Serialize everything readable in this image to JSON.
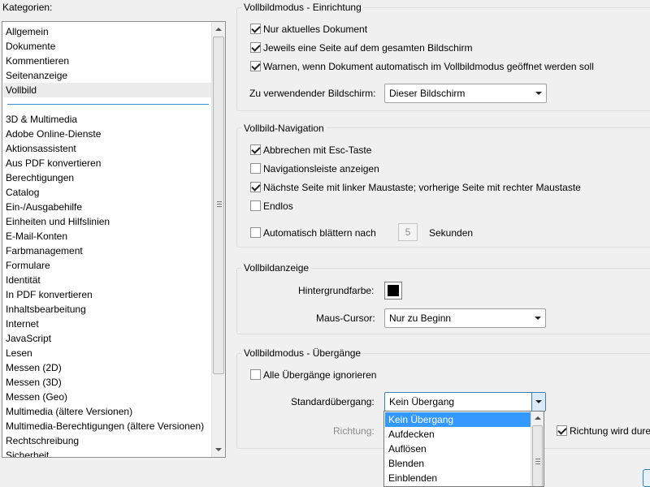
{
  "categories": {
    "label": "Kategorien:",
    "top_items": [
      "Allgemein",
      "Dokumente",
      "Kommentieren",
      "Seitenanzeige",
      "Vollbild"
    ],
    "selected": "Vollbild",
    "items": [
      "3D & Multimedia",
      "Adobe Online-Dienste",
      "Aktionsassistent",
      "Aus PDF konvertieren",
      "Berechtigungen",
      "Catalog",
      "Ein-/Ausgabehilfe",
      "Einheiten und Hilfslinien",
      "E-Mail-Konten",
      "Farbmanagement",
      "Formulare",
      "Identität",
      "In PDF konvertieren",
      "Inhaltsbearbeitung",
      "Internet",
      "JavaScript",
      "Lesen",
      "Messen (2D)",
      "Messen (3D)",
      "Messen (Geo)",
      "Multimedia (ältere Versionen)",
      "Multimedia-Berechtigungen (ältere Versionen)",
      "Rechtschreibung",
      "Sicherheit"
    ]
  },
  "setup": {
    "title": "Vollbildmodus - Einrichtung",
    "cb_current_doc": {
      "label": "Nur aktuelles Dokument",
      "checked": true
    },
    "cb_one_page": {
      "label": "Jeweils eine Seite auf dem gesamten Bildschirm",
      "checked": true
    },
    "cb_warn": {
      "label": "Warnen, wenn Dokument automatisch im Vollbildmodus geöffnet werden soll",
      "checked": true
    },
    "screen_label": "Zu verwendender Bildschirm:",
    "screen_value": "Dieser Bildschirm"
  },
  "navigation": {
    "title": "Vollbild-Navigation",
    "cb_esc": {
      "label": "Abbrechen mit Esc-Taste",
      "checked": true
    },
    "cb_navbar": {
      "label": "Navigationsleiste anzeigen",
      "checked": false
    },
    "cb_mouse": {
      "label": "Nächste Seite mit linker Maustaste; vorherige Seite mit rechter Maustaste",
      "checked": true
    },
    "cb_loop": {
      "label": "Endlos",
      "checked": false
    },
    "cb_auto": {
      "label": "Automatisch blättern nach",
      "checked": false
    },
    "seconds_value": "5",
    "seconds_unit": "Sekunden"
  },
  "display": {
    "title": "Vollbildanzeige",
    "bg_label": "Hintergrundfarbe:",
    "bg_color": "#000000",
    "cursor_label": "Maus-Cursor:",
    "cursor_value": "Nur zu Beginn"
  },
  "transitions": {
    "title": "Vollbildmodus - Übergänge",
    "cb_ignore": {
      "label": "Alle Übergänge ignorieren",
      "checked": false
    },
    "default_label": "Standardübergang:",
    "default_value": "Kein Übergang",
    "direction_label": "Richtung:",
    "cb_direction": {
      "label": "Richtung wird dure",
      "checked": true
    },
    "options": [
      "Kein Übergang",
      "Aufdecken",
      "Auflösen",
      "Blenden",
      "Einblenden"
    ],
    "highlighted": "Kein Übergang"
  }
}
